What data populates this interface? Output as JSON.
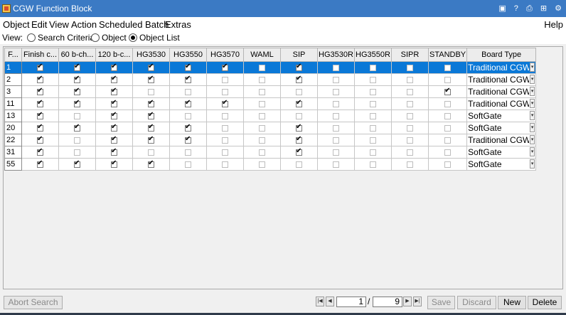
{
  "window": {
    "title": "CGW Function Block",
    "icons": [
      "screen-icon",
      "help-icon",
      "print-icon",
      "network-icon",
      "settings-icon"
    ]
  },
  "menu": {
    "items": [
      "Object",
      "Edit",
      "View",
      "Action",
      "Scheduled Batch",
      "Extras"
    ],
    "help": "Help"
  },
  "view": {
    "label": "View:",
    "options": [
      {
        "label": "Search Criteria",
        "selected": false
      },
      {
        "label": "Object",
        "selected": false
      },
      {
        "label": "Object List",
        "selected": true
      }
    ]
  },
  "grid": {
    "headers": [
      "F...",
      "Finish c...",
      "60 b-ch...",
      "120 b-c...",
      "HG3530",
      "HG3550",
      "HG3570",
      "WAML",
      "SIP",
      "HG3530R",
      "HG3550R",
      "SIPR",
      "STANDBY",
      "Board Type"
    ],
    "rows": [
      {
        "id": "1",
        "checks": [
          true,
          true,
          true,
          true,
          true,
          true,
          false,
          true,
          false,
          false,
          false,
          false
        ],
        "board": "Traditional CGW Bo",
        "selected": true
      },
      {
        "id": "2",
        "checks": [
          true,
          true,
          true,
          true,
          true,
          false,
          false,
          true,
          false,
          false,
          false,
          false
        ],
        "board": "Traditional CGW Bo",
        "selected": false
      },
      {
        "id": "3",
        "checks": [
          true,
          true,
          true,
          false,
          false,
          false,
          false,
          false,
          false,
          false,
          false,
          true
        ],
        "board": "Traditional CGW Bo",
        "selected": false
      },
      {
        "id": "11",
        "checks": [
          true,
          true,
          true,
          true,
          true,
          true,
          false,
          true,
          false,
          false,
          false,
          false
        ],
        "board": "Traditional CGW Bo",
        "selected": false
      },
      {
        "id": "13",
        "checks": [
          true,
          false,
          true,
          true,
          false,
          false,
          false,
          false,
          false,
          false,
          false,
          false
        ],
        "board": "SoftGate",
        "selected": false
      },
      {
        "id": "20",
        "checks": [
          true,
          true,
          true,
          true,
          true,
          false,
          false,
          true,
          false,
          false,
          false,
          false
        ],
        "board": "SoftGate",
        "selected": false
      },
      {
        "id": "22",
        "checks": [
          true,
          false,
          true,
          true,
          true,
          false,
          false,
          true,
          false,
          false,
          false,
          false
        ],
        "board": "Traditional CGW Bo",
        "selected": false
      },
      {
        "id": "31",
        "checks": [
          true,
          false,
          true,
          false,
          false,
          false,
          false,
          true,
          false,
          false,
          false,
          false
        ],
        "board": "SoftGate",
        "selected": false
      },
      {
        "id": "55",
        "checks": [
          true,
          true,
          true,
          true,
          false,
          false,
          false,
          false,
          false,
          false,
          false,
          false
        ],
        "board": "SoftGate",
        "selected": false
      }
    ]
  },
  "bottom": {
    "abort": "Abort Search",
    "page_current": "1",
    "page_sep": "/",
    "page_total": "9",
    "save": "Save",
    "discard": "Discard",
    "new": "New",
    "delete": "Delete"
  }
}
